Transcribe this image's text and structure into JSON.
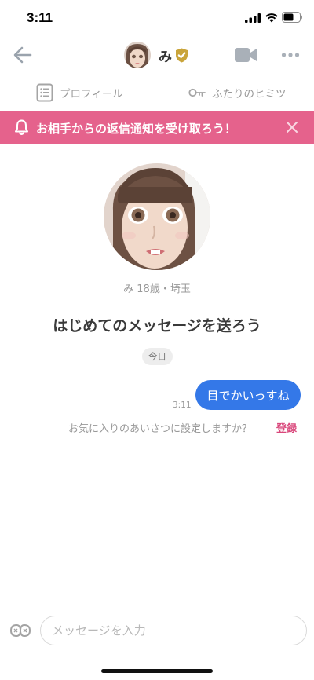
{
  "status_bar": {
    "time": "3:11"
  },
  "header": {
    "name": "み",
    "icons": {
      "back": "arrow-left-icon",
      "verified": "verified-shield-icon",
      "video": "video-camera-icon",
      "more": "more-dots-icon"
    }
  },
  "tabs": [
    {
      "label": "プロフィール",
      "icon": "profile-list-icon"
    },
    {
      "label": "ふたりのヒミツ",
      "icon": "key-icon"
    }
  ],
  "banner": {
    "text": "お相手からの返信通知を受け取ろう！",
    "color": "#e5628c",
    "icons": {
      "bell": "bell-icon",
      "close": "close-icon"
    }
  },
  "profile": {
    "meta": "み 18歳・埼玉"
  },
  "prompt_title": "はじめてのメッセージを送ろう",
  "date_chip": "今日",
  "messages": [
    {
      "text": "目でかいっすね",
      "time": "3:11",
      "from": "self"
    }
  ],
  "greeting_prompt": {
    "question": "お気に入りのあいさつに設定しますか？",
    "action": "登録"
  },
  "composer": {
    "placeholder": "メッセージを入力",
    "value": "",
    "sticker_icon": "sticker-icon"
  },
  "colors": {
    "accent_pink": "#e5628c",
    "bubble_blue": "#3478e8",
    "link_pink": "#d9477b"
  }
}
